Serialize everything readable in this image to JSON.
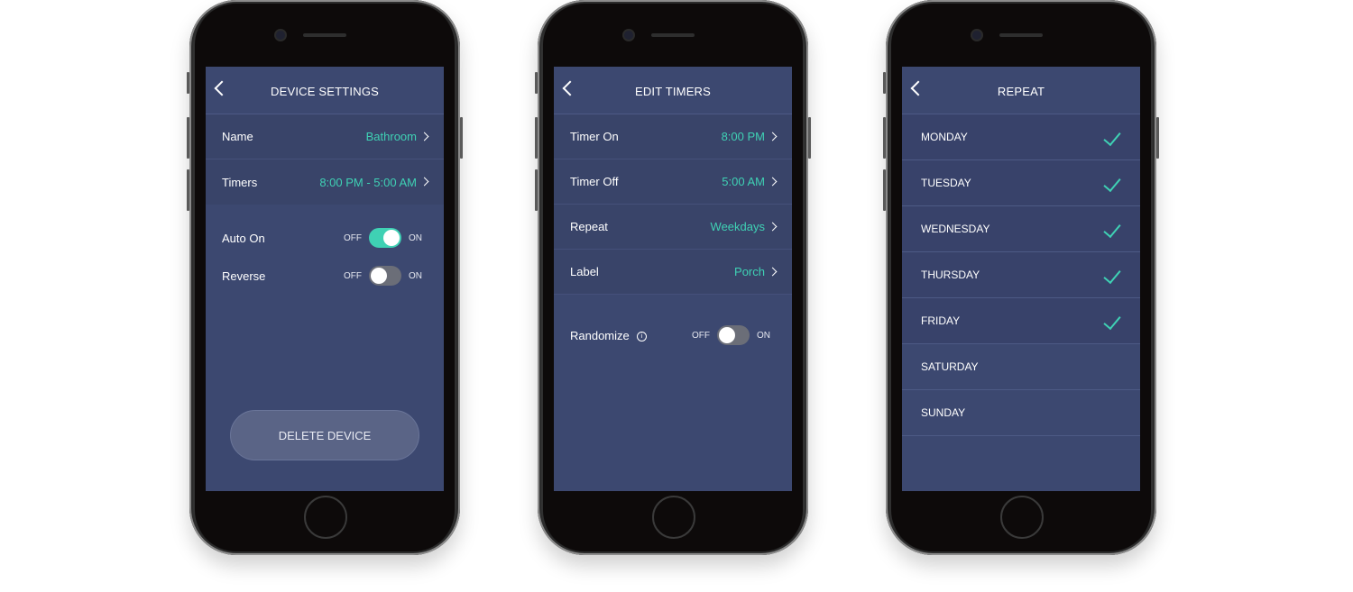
{
  "device_settings": {
    "title": "DEVICE SETTINGS",
    "rows": [
      {
        "label": "Name",
        "value": "Bathroom"
      },
      {
        "label": "Timers",
        "value": "8:00 PM - 5:00 AM"
      }
    ],
    "toggles": [
      {
        "label": "Auto On",
        "off_label": "OFF",
        "on_label": "ON",
        "state": "on"
      },
      {
        "label": "Reverse",
        "off_label": "OFF",
        "on_label": "ON",
        "state": "off"
      }
    ],
    "delete_label": "DELETE DEVICE"
  },
  "edit_timers": {
    "title": "EDIT TIMERS",
    "rows": [
      {
        "label": "Timer On",
        "value": "8:00 PM"
      },
      {
        "label": "Timer Off",
        "value": "5:00 AM"
      },
      {
        "label": "Repeat",
        "value": "Weekdays"
      },
      {
        "label": "Label",
        "value": "Porch"
      }
    ],
    "randomize": {
      "label": "Randomize",
      "off_label": "OFF",
      "on_label": "ON",
      "state": "off"
    }
  },
  "repeat": {
    "title": "REPEAT",
    "days": [
      {
        "label": "MONDAY",
        "checked": true
      },
      {
        "label": "TUESDAY",
        "checked": true
      },
      {
        "label": "WEDNESDAY",
        "checked": true
      },
      {
        "label": "THURSDAY",
        "checked": true
      },
      {
        "label": "FRIDAY",
        "checked": true
      },
      {
        "label": "SATURDAY",
        "checked": false
      },
      {
        "label": "SUNDAY",
        "checked": false
      }
    ]
  },
  "colors": {
    "screen_bg": "#3c4870",
    "accent": "#3fd1b4",
    "text": "#ffffff"
  },
  "icons": [
    "back-chevron-icon",
    "chevron-right-icon",
    "info-icon",
    "checkmark-icon"
  ]
}
